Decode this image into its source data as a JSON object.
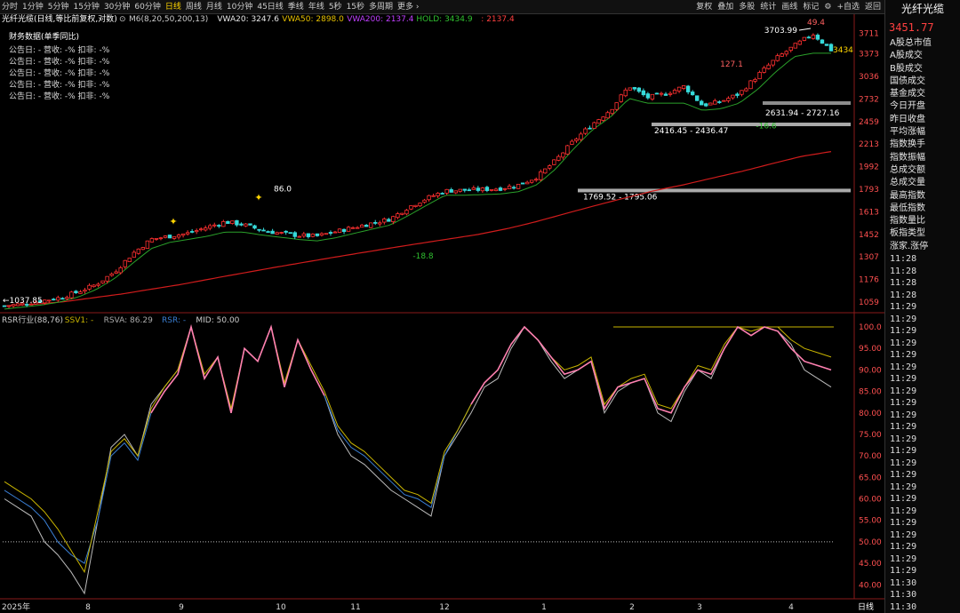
{
  "toolbar": {
    "periods": [
      "分时",
      "1分钟",
      "5分钟",
      "15分钟",
      "30分钟",
      "60分钟",
      "日线",
      "周线",
      "月线",
      "10分钟",
      "45日线",
      "季线",
      "年线",
      "5秒",
      "15秒",
      "多周期",
      "更多 ›"
    ],
    "active": "日线",
    "actions": [
      "复权",
      "叠加",
      "多股",
      "统计",
      "画线",
      "标记",
      "+自选",
      "返回"
    ],
    "gear_icon": "gear-icon"
  },
  "main": {
    "legend_title": "光纤光缆(日线,等比前复权,对数)",
    "legend_items": [
      {
        "text": "M6(8,20,50,200,13)",
        "color": "#cccccc"
      },
      {
        "text": "VWA20: 3247.6",
        "color": "#e8e8e8"
      },
      {
        "text": "VWA50: 2898.0",
        "color": "#e6c000"
      },
      {
        "text": "VWA200: 2137.4",
        "color": "#c040ff"
      },
      {
        "text": "HOLD: 3434.9 ",
        "color": "#30c030"
      },
      {
        "text": ": 2137.4",
        "color": "#ff4040"
      }
    ],
    "fin_title": "财务数据(单季同比)",
    "fin_rows": [
      "公告日: -    营收: -%    扣非: -%",
      "公告日: -    营收: -%    扣非: -%",
      "公告日: -    营收: -%    扣非: -%",
      "公告日: -    营收: -%    扣非: -%",
      "公告日: -    营收: -%    扣非: -%"
    ],
    "y_labels": [
      "3711",
      "3373",
      "3036",
      "2732",
      "2459",
      "2213",
      "1992",
      "1793",
      "1613",
      "1452",
      "1307",
      "1176",
      "1059"
    ],
    "annotations": {
      "low_start": "←1037.85",
      "peak1": "86.0",
      "dip1": "-18.8",
      "peak2": "127.1",
      "high": "3703.99",
      "high_pct": "49.4",
      "dip2": "-16.6",
      "last_price": "3434",
      "zone1": "1769.52 - 1795.06",
      "zone2": "2416.45 - 2436.47",
      "zone3": "2631.94 - 2727.16"
    }
  },
  "rsr": {
    "legend": [
      {
        "text": "RSR行业(88,76)",
        "color": "#cccccc"
      },
      {
        "text": "SSV1: -",
        "color": "#c8b400"
      },
      {
        "text": "RSVA: 86.29",
        "color": "#aaaaaa"
      },
      {
        "text": "RSR: -",
        "color": "#3a7fd5"
      },
      {
        "text": "MID: 50.00",
        "color": "#cccccc"
      }
    ],
    "y_labels": [
      "100.0",
      "95.00",
      "90.00",
      "85.00",
      "80.00",
      "75.00",
      "70.00",
      "65.00",
      "60.00",
      "55.00",
      "50.00",
      "45.00",
      "40.00"
    ]
  },
  "x_axis": {
    "labels": [
      "2025年",
      "8",
      "9",
      "10",
      "11",
      "12",
      "1",
      "2",
      "3",
      "4"
    ],
    "period_label": "日线"
  },
  "sidebar": {
    "title": "光纤光缆",
    "price": "3451.77",
    "items": [
      "A股总市值",
      "A股成交",
      "B股成交",
      "国债成交",
      "基金成交",
      "今日开盘",
      "昨日收盘",
      "平均涨幅",
      "指数换手",
      "指数振幅",
      "总成交额",
      "总成交量",
      "最高指数",
      "最低指数",
      "指数量比",
      "板指类型",
      "涨家.涨停"
    ],
    "times": [
      "11:28",
      "11:28",
      "11:28",
      "11:28",
      "11:29",
      "11:29",
      "11:29",
      "11:29",
      "11:29",
      "11:29",
      "11:29",
      "11:29",
      "11:29",
      "11:29",
      "11:29",
      "11:29",
      "11:29",
      "11:29",
      "11:29",
      "11:29",
      "11:29",
      "11:29",
      "11:29",
      "11:29",
      "11:29",
      "11:29",
      "11:29",
      "11:30",
      "11:30",
      "11:30"
    ]
  },
  "chart_data": [
    {
      "type": "candlestick",
      "title": "光纤光缆(日线,等比前复权,对数)",
      "scale": "log",
      "ylim": [
        1037,
        3750
      ],
      "x_ticks": [
        "2025年",
        "8",
        "9",
        "10",
        "11",
        "12",
        "1",
        "2",
        "3",
        "4"
      ],
      "close_path": [
        1040,
        1050,
        1065,
        1080,
        1110,
        1150,
        1220,
        1330,
        1420,
        1440,
        1460,
        1500,
        1540,
        1520,
        1480,
        1460,
        1445,
        1440,
        1470,
        1500,
        1530,
        1560,
        1650,
        1720,
        1780,
        1785,
        1790,
        1800,
        1830,
        1900,
        2050,
        2250,
        2430,
        2600,
        2900,
        2750,
        2800,
        2900,
        2650,
        2700,
        2800,
        3050,
        3300,
        3500,
        3703,
        3434
      ],
      "hold_path": [
        1040,
        1050,
        1060,
        1075,
        1100,
        1140,
        1200,
        1290,
        1380,
        1420,
        1440,
        1460,
        1490,
        1490,
        1470,
        1455,
        1440,
        1430,
        1450,
        1480,
        1510,
        1540,
        1610,
        1690,
        1770,
        1770,
        1775,
        1780,
        1800,
        1860,
        2000,
        2200,
        2400,
        2550,
        2780,
        2720,
        2720,
        2720,
        2630,
        2650,
        2720,
        2900,
        3150,
        3380,
        3434,
        3434
      ],
      "vwa200_path": [
        1040,
        1048,
        1060,
        1080,
        1100,
        1125,
        1150,
        1180,
        1210,
        1240,
        1270,
        1300,
        1330,
        1360,
        1390,
        1420,
        1450,
        1490,
        1540,
        1600,
        1660,
        1720,
        1780,
        1830,
        1890,
        1950,
        2020,
        2090,
        2137
      ],
      "series": [
        {
          "name": "HOLD",
          "last": 3434.9
        },
        {
          "name": "VWA20",
          "last": 3247.6
        },
        {
          "name": "VWA50",
          "last": 2898.0
        },
        {
          "name": "VWA200",
          "last": 2137.4
        }
      ],
      "levels": [
        {
          "label": "1769.52 - 1795.06",
          "value": 1782
        },
        {
          "label": "2416.45 - 2436.47",
          "value": 2426
        },
        {
          "label": "2631.94 - 2727.16",
          "value": 2680
        }
      ],
      "annotations": [
        {
          "text": "1037.85",
          "value": 1037.85
        },
        {
          "text": "86.0",
          "value": 1730
        },
        {
          "text": "-18.8",
          "value": 1320
        },
        {
          "text": "127.1",
          "value": 3050
        },
        {
          "text": "3703.99",
          "value": 3703.99
        },
        {
          "text": "49.4",
          "value": 3703.99
        },
        {
          "text": "-16.6",
          "value": 2460
        }
      ]
    },
    {
      "type": "line",
      "title": "RSR行业(88,76)",
      "ylim": [
        38,
        100
      ],
      "mid": 50,
      "series": [
        {
          "name": "RSVA",
          "color": "#bbbbbb",
          "values": [
            60,
            58,
            56,
            50,
            47,
            43,
            38,
            55,
            72,
            75,
            70,
            82,
            86,
            90,
            100,
            88,
            93,
            80,
            95,
            92,
            100,
            86,
            97,
            90,
            84,
            75,
            70,
            68,
            65,
            62,
            60,
            58,
            56,
            70,
            75,
            80,
            86,
            88,
            95,
            100,
            97,
            92,
            88,
            90,
            92,
            80,
            85,
            87,
            88,
            80,
            78,
            85,
            90,
            88,
            95,
            100,
            98,
            100,
            99,
            96,
            90,
            88,
            86
          ]
        },
        {
          "name": "RSR",
          "color": "#3a7fd5",
          "values": [
            62,
            60,
            58,
            55,
            50,
            47,
            45,
            55,
            70,
            73,
            69,
            80,
            85,
            89,
            100,
            88,
            93,
            80,
            95,
            92,
            100,
            86,
            97,
            90,
            84,
            76,
            72,
            70,
            67,
            64,
            61,
            60,
            58,
            70,
            76,
            82,
            87,
            90,
            96,
            100,
            97,
            93,
            89,
            90,
            92,
            81,
            86,
            87,
            88,
            81,
            80,
            86,
            90,
            89,
            95,
            100,
            98,
            100,
            99,
            95,
            92,
            91,
            90
          ]
        },
        {
          "name": "SSV1",
          "color": "#c8b400",
          "values": [
            64,
            62,
            60,
            57,
            53,
            48,
            43,
            57,
            71,
            74,
            70,
            81,
            86,
            90,
            100,
            89,
            93,
            81,
            95,
            92,
            100,
            87,
            97,
            91,
            85,
            77,
            73,
            71,
            68,
            65,
            62,
            61,
            59,
            71,
            76,
            82,
            87,
            90,
            96,
            100,
            97,
            93,
            90,
            91,
            93,
            82,
            86,
            88,
            89,
            82,
            81,
            86,
            91,
            90,
            96,
            100,
            99,
            100,
            100,
            97,
            95,
            94,
            93
          ]
        }
      ]
    }
  ]
}
